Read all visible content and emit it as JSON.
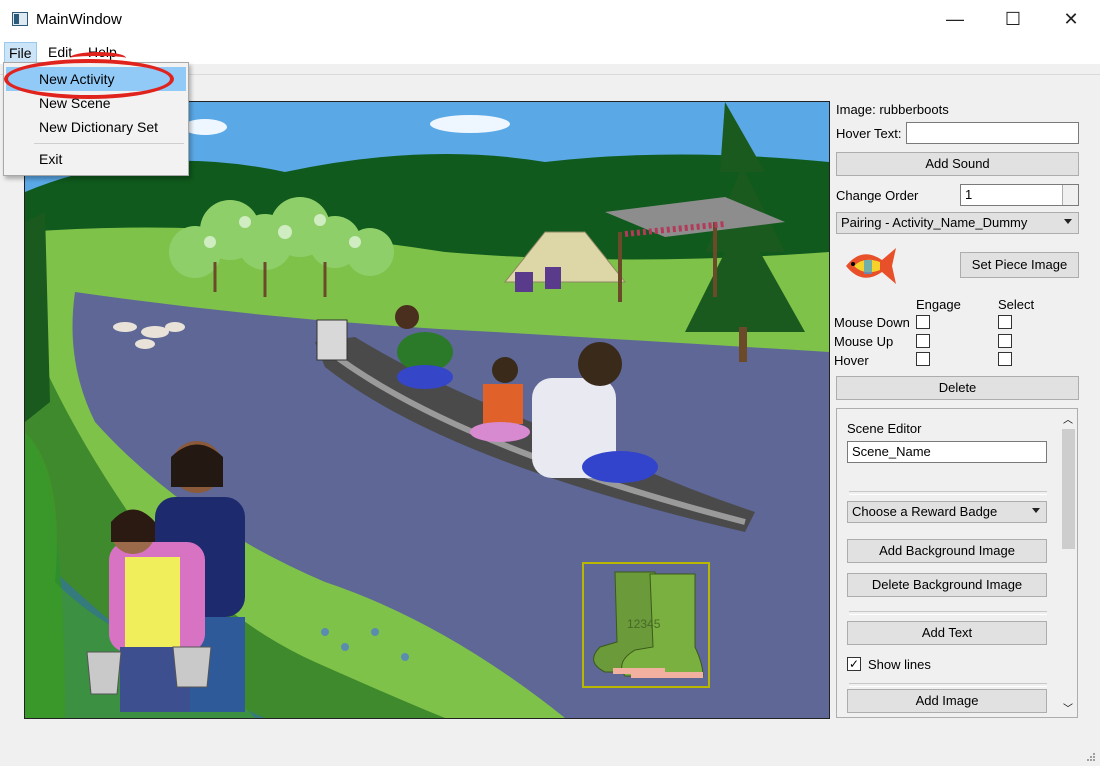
{
  "window": {
    "title": "MainWindow",
    "minimize_glyph": "—",
    "maximize_glyph": "☐",
    "close_glyph": "✕"
  },
  "menubar": {
    "file": "File",
    "edit": "Edit",
    "help": "Help"
  },
  "file_menu": {
    "items": [
      "New Activity",
      "New Scene",
      "New Dictionary Set",
      "Exit"
    ],
    "highlighted": "New Activity",
    "annotation_color": "#e0231d"
  },
  "scene_image": {
    "boots_watermark": "12345"
  },
  "properties": {
    "image_label": "Image: rubberboots",
    "hover_text_label": "Hover Text:",
    "hover_text_value": "",
    "add_sound": "Add Sound",
    "change_order_label": "Change Order",
    "change_order_value": "1",
    "pairing_value": "Pairing - Activity_Name_Dummy",
    "set_piece_image": "Set Piece Image",
    "engage_header": "Engage",
    "select_header": "Select",
    "rows": [
      "Mouse Down",
      "Mouse Up",
      "Hover"
    ],
    "delete": "Delete"
  },
  "scene_editor": {
    "title": "Scene Editor",
    "scene_name_value": "Scene_Name",
    "reward_badge": "Choose a Reward Badge",
    "add_background": "Add Background Image",
    "delete_background": "Delete Background Image",
    "add_text": "Add Text",
    "show_lines_label": "Show lines",
    "show_lines_checked": true,
    "add_image": "Add Image"
  }
}
